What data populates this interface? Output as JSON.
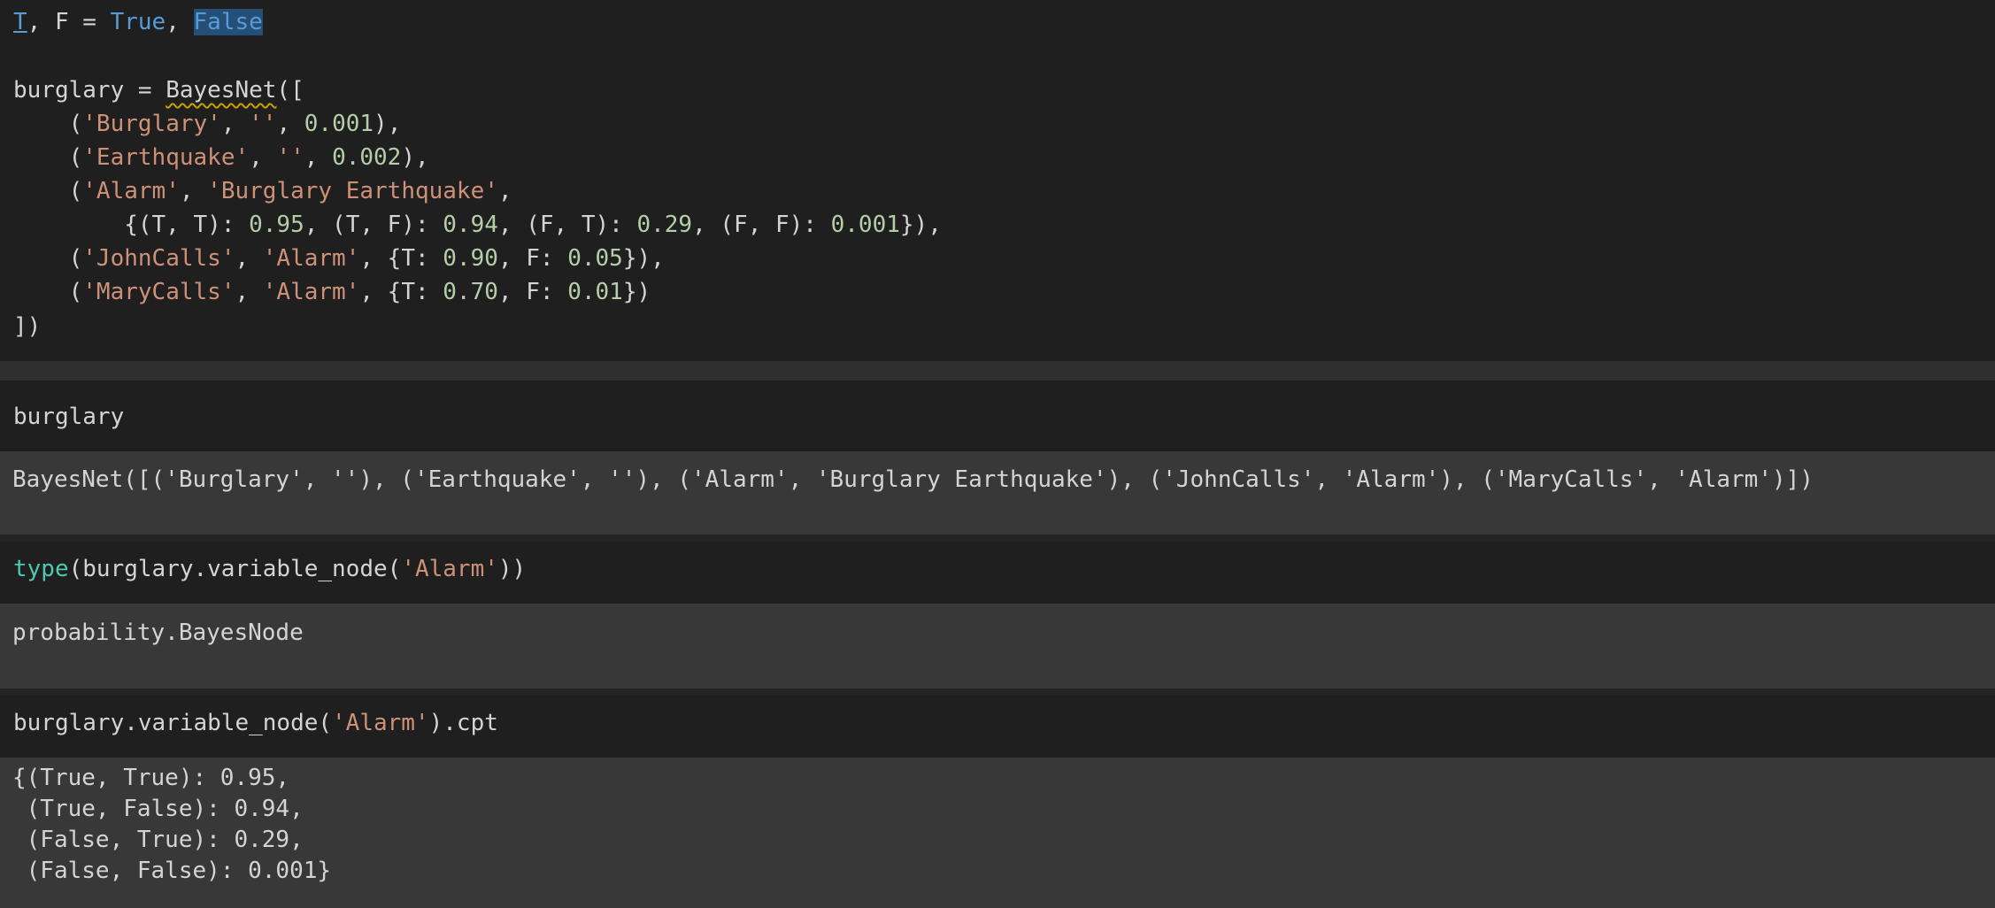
{
  "cells": [
    {
      "kind": "code",
      "lines": [
        [
          [
            "T",
            "kw und"
          ],
          [
            ", F = ",
            ""
          ],
          [
            "True",
            "kw"
          ],
          [
            ", ",
            ""
          ],
          [
            "False",
            "sel"
          ]
        ],
        [],
        [
          [
            "burglary = ",
            ""
          ],
          [
            "BayesNet",
            "squig"
          ],
          [
            "([",
            ""
          ]
        ],
        [
          [
            "    (",
            ""
          ],
          [
            "'Burglary'",
            "str"
          ],
          [
            ", ",
            ""
          ],
          [
            "''",
            "str"
          ],
          [
            ", ",
            ""
          ],
          [
            "0.001",
            "num"
          ],
          [
            "),",
            ""
          ]
        ],
        [
          [
            "    (",
            ""
          ],
          [
            "'Earthquake'",
            "str"
          ],
          [
            ", ",
            ""
          ],
          [
            "''",
            "str"
          ],
          [
            ", ",
            ""
          ],
          [
            "0.002",
            "num"
          ],
          [
            "),",
            ""
          ]
        ],
        [
          [
            "    (",
            ""
          ],
          [
            "'Alarm'",
            "str"
          ],
          [
            ", ",
            ""
          ],
          [
            "'Burglary Earthquake'",
            "str"
          ],
          [
            ",",
            ""
          ]
        ],
        [
          [
            "        {(T, T): ",
            ""
          ],
          [
            "0.95",
            "num"
          ],
          [
            ", (T, F): ",
            ""
          ],
          [
            "0.94",
            "num"
          ],
          [
            ", (F, T): ",
            ""
          ],
          [
            "0.29",
            "num"
          ],
          [
            ", (F, F): ",
            ""
          ],
          [
            "0.001",
            "num"
          ],
          [
            "}),",
            ""
          ]
        ],
        [
          [
            "    (",
            ""
          ],
          [
            "'JohnCalls'",
            "str"
          ],
          [
            ", ",
            ""
          ],
          [
            "'Alarm'",
            "str"
          ],
          [
            ", {T: ",
            ""
          ],
          [
            "0.90",
            "num"
          ],
          [
            ", F: ",
            ""
          ],
          [
            "0.05",
            "num"
          ],
          [
            "}),",
            ""
          ]
        ],
        [
          [
            "    (",
            ""
          ],
          [
            "'MaryCalls'",
            "str"
          ],
          [
            ", ",
            ""
          ],
          [
            "'Alarm'",
            "str"
          ],
          [
            ", {T: ",
            ""
          ],
          [
            "0.70",
            "num"
          ],
          [
            ", F: ",
            ""
          ],
          [
            "0.01",
            "num"
          ],
          [
            "})",
            ""
          ]
        ],
        [
          [
            "])",
            ""
          ]
        ]
      ]
    },
    {
      "kind": "code",
      "lines": [
        [
          [
            "burglary",
            ""
          ]
        ]
      ]
    },
    {
      "kind": "output",
      "lines": [
        [
          [
            "BayesNet([('Burglary', ''), ('Earthquake', ''), ('Alarm', 'Burglary Earthquake'), ('JohnCalls', 'Alarm'), ('MaryCalls', 'Alarm')])",
            ""
          ]
        ]
      ]
    },
    {
      "kind": "code",
      "lines": [
        [
          [
            "type",
            "fn"
          ],
          [
            "(burglary.variable_node(",
            ""
          ],
          [
            "'Alarm'",
            "str"
          ],
          [
            "))",
            ""
          ]
        ]
      ]
    },
    {
      "kind": "output",
      "lines": [
        [
          [
            "probability.BayesNode",
            ""
          ]
        ]
      ]
    },
    {
      "kind": "code",
      "lines": [
        [
          [
            "burglary.variable_node(",
            ""
          ],
          [
            "'Alarm'",
            "str"
          ],
          [
            ").cpt",
            ""
          ]
        ]
      ]
    },
    {
      "kind": "output",
      "lines": [
        [
          [
            "{(True, True): 0.95,",
            ""
          ]
        ],
        [
          [
            " (True, False): 0.94,",
            ""
          ]
        ],
        [
          [
            " (False, True): 0.29,",
            ""
          ]
        ],
        [
          [
            " (False, False): 0.001}",
            ""
          ]
        ]
      ]
    }
  ]
}
